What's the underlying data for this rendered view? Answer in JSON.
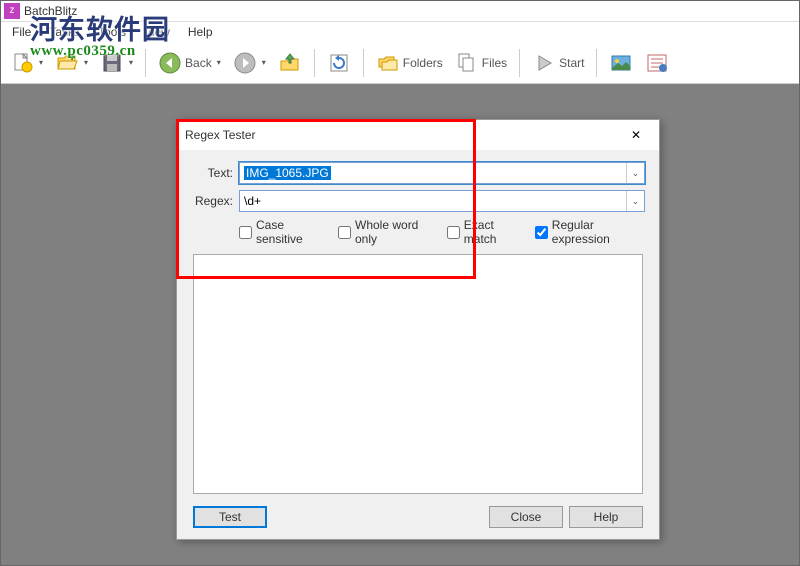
{
  "app": {
    "title": "BatchBlitz"
  },
  "menubar": {
    "items": [
      "File",
      "Tasks",
      "Tools",
      "View",
      "Help"
    ]
  },
  "toolbar": {
    "back_label": "Back",
    "folders_label": "Folders",
    "files_label": "Files",
    "start_label": "Start"
  },
  "watermark": {
    "line1": "河东软件园",
    "line2": "www.pc0359.cn"
  },
  "dialog": {
    "title": "Regex Tester",
    "text_label": "Text:",
    "text_value": "IMG_1065.JPG",
    "regex_label": "Regex:",
    "regex_value": "\\d+",
    "checks": {
      "case_sensitive": {
        "label": "Case sensitive",
        "checked": false
      },
      "whole_word": {
        "label": "Whole word only",
        "checked": false
      },
      "exact_match": {
        "label": "Exact match",
        "checked": false
      },
      "regex": {
        "label": "Regular expression",
        "checked": true
      }
    },
    "buttons": {
      "test": "Test",
      "close": "Close",
      "help": "Help"
    }
  }
}
